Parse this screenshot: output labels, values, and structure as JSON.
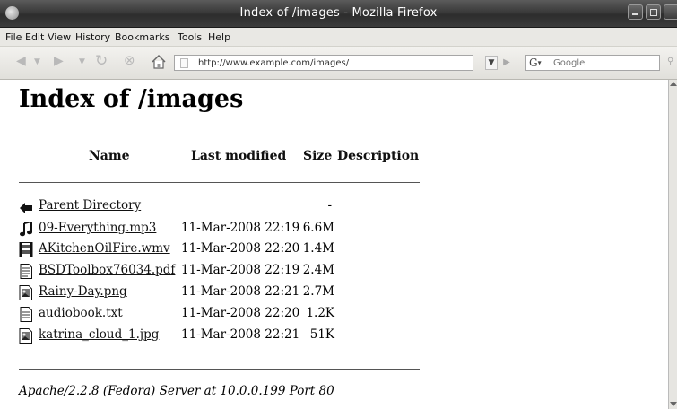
{
  "window": {
    "title": "Index of /images - Mozilla Firefox"
  },
  "menu": [
    "File",
    "Edit",
    "View",
    "History",
    "Bookmarks",
    "Tools",
    "Help"
  ],
  "toolbar": {
    "url": "http://www.example.com/images/",
    "search_engine": "G",
    "search_placeholder": "Google"
  },
  "page": {
    "heading": "Index of /images",
    "columns": {
      "name": "Name",
      "modified": "Last modified",
      "size": "Size",
      "description": "Description"
    },
    "parent": {
      "name": "Parent Directory",
      "size": "-"
    },
    "files": [
      {
        "name": "09-Everything.mp3",
        "modified": "11-Mar-2008 22:19",
        "size": "6.6M",
        "icon": "audio-file-icon"
      },
      {
        "name": "AKitchenOilFire.wmv",
        "modified": "11-Mar-2008 22:20",
        "size": "1.4M",
        "icon": "video-file-icon"
      },
      {
        "name": "BSDToolbox76034.pdf",
        "modified": "11-Mar-2008 22:19",
        "size": "2.4M",
        "icon": "document-file-icon"
      },
      {
        "name": "Rainy-Day.png",
        "modified": "11-Mar-2008 22:21",
        "size": "2.7M",
        "icon": "image-file-icon"
      },
      {
        "name": "audiobook.txt",
        "modified": "11-Mar-2008 22:20",
        "size": "1.2K",
        "icon": "text-file-icon"
      },
      {
        "name": "katrina_cloud_1.jpg",
        "modified": "11-Mar-2008 22:21",
        "size": "51K",
        "icon": "image-file-icon"
      }
    ],
    "address": "Apache/2.2.8 (Fedora) Server at 10.0.0.199 Port 80"
  }
}
